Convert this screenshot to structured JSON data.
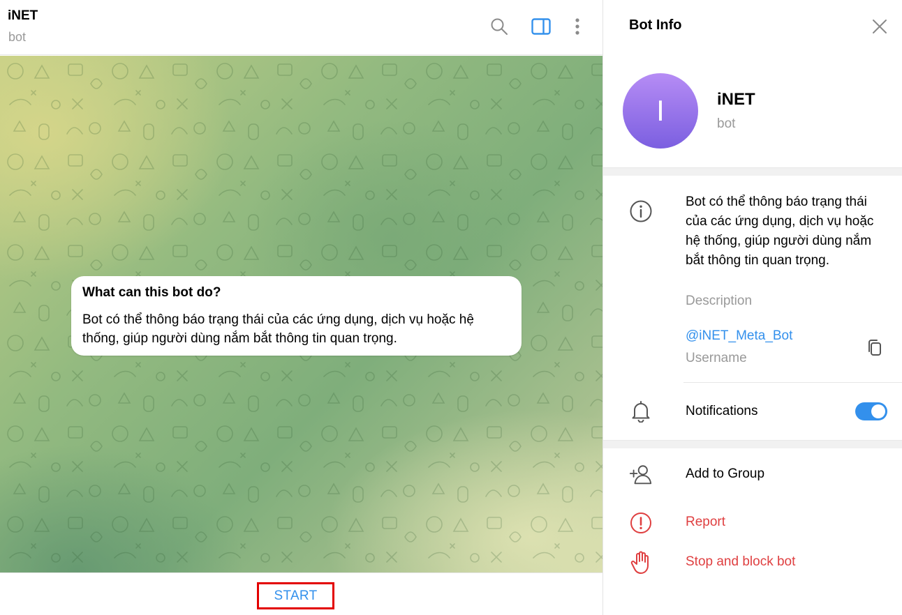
{
  "chat": {
    "title": "iNET",
    "subtitle": "bot",
    "icons": {
      "search": "search-icon",
      "panel": "sidebar-toggle-icon",
      "more": "more-vertical-icon"
    },
    "bot_card": {
      "title": "What can this bot do?",
      "text": "Bot có thể thông báo trạng thái của các ứng dụng, dịch vụ hoặc hệ thống, giúp người dùng nắm bắt thông tin quan trọng."
    },
    "start_label": "START"
  },
  "info": {
    "title": "Bot Info",
    "avatar_letter": "I",
    "name": "iNET",
    "type": "bot",
    "description": "Bot có thể thông báo trạng thái của các ứng dụng, dịch vụ hoặc hệ thống, giúp người dùng nắm bắt thông tin quan trọng.",
    "description_label": "Description",
    "username": "@iNET_Meta_Bot",
    "username_label": "Username",
    "notifications_label": "Notifications",
    "notifications_on": true,
    "actions": {
      "add_to_group": "Add to Group",
      "report": "Report",
      "stop_block": "Stop and block bot"
    }
  },
  "colors": {
    "accent": "#3390ec",
    "danger": "#df3f40",
    "highlight_border": "#e30000",
    "avatar_top": "#b68cf5",
    "avatar_bottom": "#7b5fe0"
  }
}
